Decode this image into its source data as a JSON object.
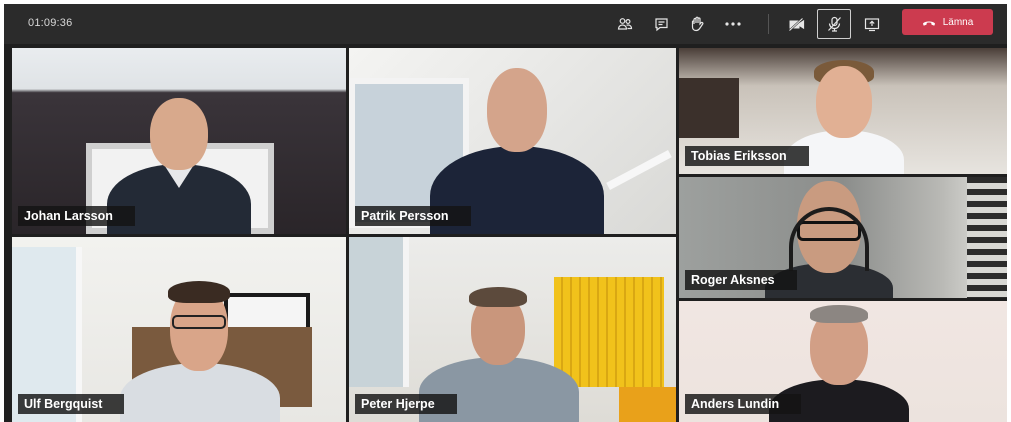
{
  "call": {
    "timer": "01:09:36",
    "leave_label": "Lämna"
  },
  "toolbar": {
    "icons": [
      "participants-icon",
      "chat-icon",
      "raise-hand-icon",
      "more-icon",
      "camera-off-icon",
      "mic-off-icon",
      "share-screen-icon",
      "hang-up-icon"
    ]
  },
  "participants": [
    {
      "name": "Johan Larsson"
    },
    {
      "name": "Patrik Persson"
    },
    {
      "name": "Tobias Eriksson"
    },
    {
      "name": "Roger Aksnes"
    },
    {
      "name": "Ulf Bergquist"
    },
    {
      "name": "Peter Hjerpe"
    },
    {
      "name": "Anders Lundin"
    }
  ],
  "colors": {
    "leave_button": "#cc3b4f",
    "topbar": "#2b2b2b",
    "name_tag_bg": "#141414"
  }
}
